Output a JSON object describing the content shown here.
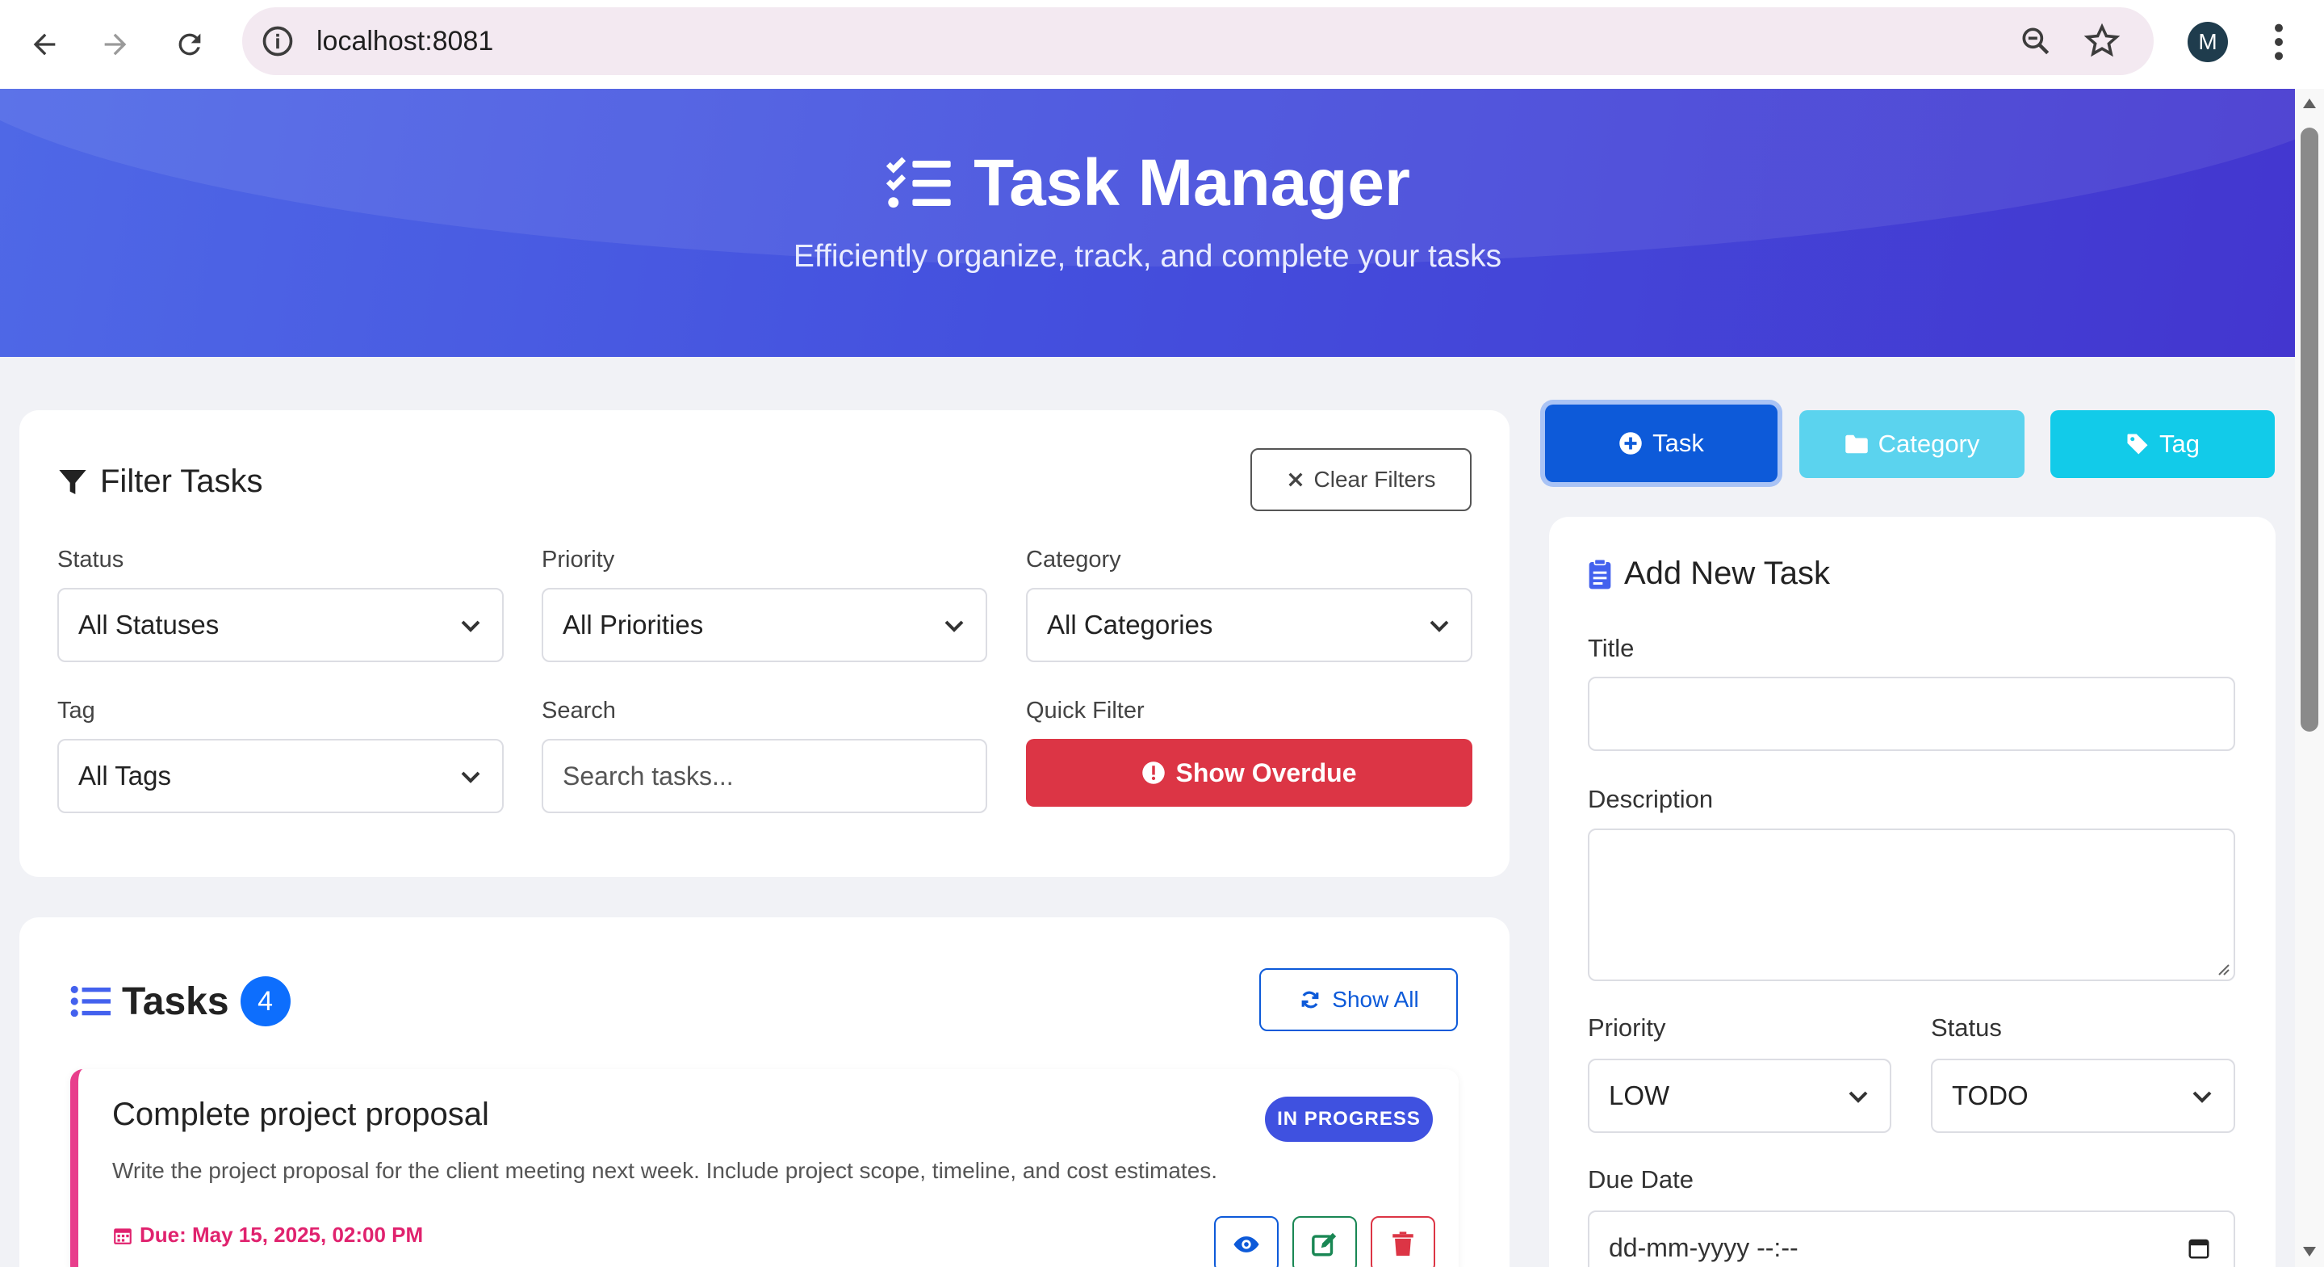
{
  "browser": {
    "url": "localhost:8081",
    "avatar_letter": "M"
  },
  "hero": {
    "title": "Task Manager",
    "subtitle": "Efficiently organize, track, and complete your tasks"
  },
  "filter": {
    "title": "Filter Tasks",
    "clear_label": "Clear Filters",
    "status_label": "Status",
    "status_value": "All Statuses",
    "priority_label": "Priority",
    "priority_value": "All Priorities",
    "category_label": "Category",
    "category_value": "All Categories",
    "tag_label": "Tag",
    "tag_value": "All Tags",
    "search_label": "Search",
    "search_placeholder": "Search tasks...",
    "quick_label": "Quick Filter",
    "overdue_label": "Show Overdue"
  },
  "tabs": {
    "task": "Task",
    "category": "Category",
    "tag": "Tag"
  },
  "tasks": {
    "title": "Tasks",
    "count": "4",
    "show_all_label": "Show All",
    "items": [
      {
        "title": "Complete project proposal",
        "description": "Write the project proposal for the client meeting next week. Include project scope, timeline, and cost estimates.",
        "due": "Due: May 15, 2025, 02:00 PM",
        "status": "IN PROGRESS"
      }
    ]
  },
  "form": {
    "title": "Add New Task",
    "title_label": "Title",
    "description_label": "Description",
    "priority_label": "Priority",
    "priority_value": "LOW",
    "status_label": "Status",
    "status_value": "TODO",
    "due_label": "Due Date",
    "due_placeholder": "dd-mm-yyyy --:--"
  },
  "colors": {
    "primary": "#0d5ad9",
    "danger": "#dc3545",
    "hero_start": "#4f68e6",
    "hero_end": "#4336cf",
    "status_in_progress": "#3f51e0",
    "task_accent": "#e83e8c"
  }
}
